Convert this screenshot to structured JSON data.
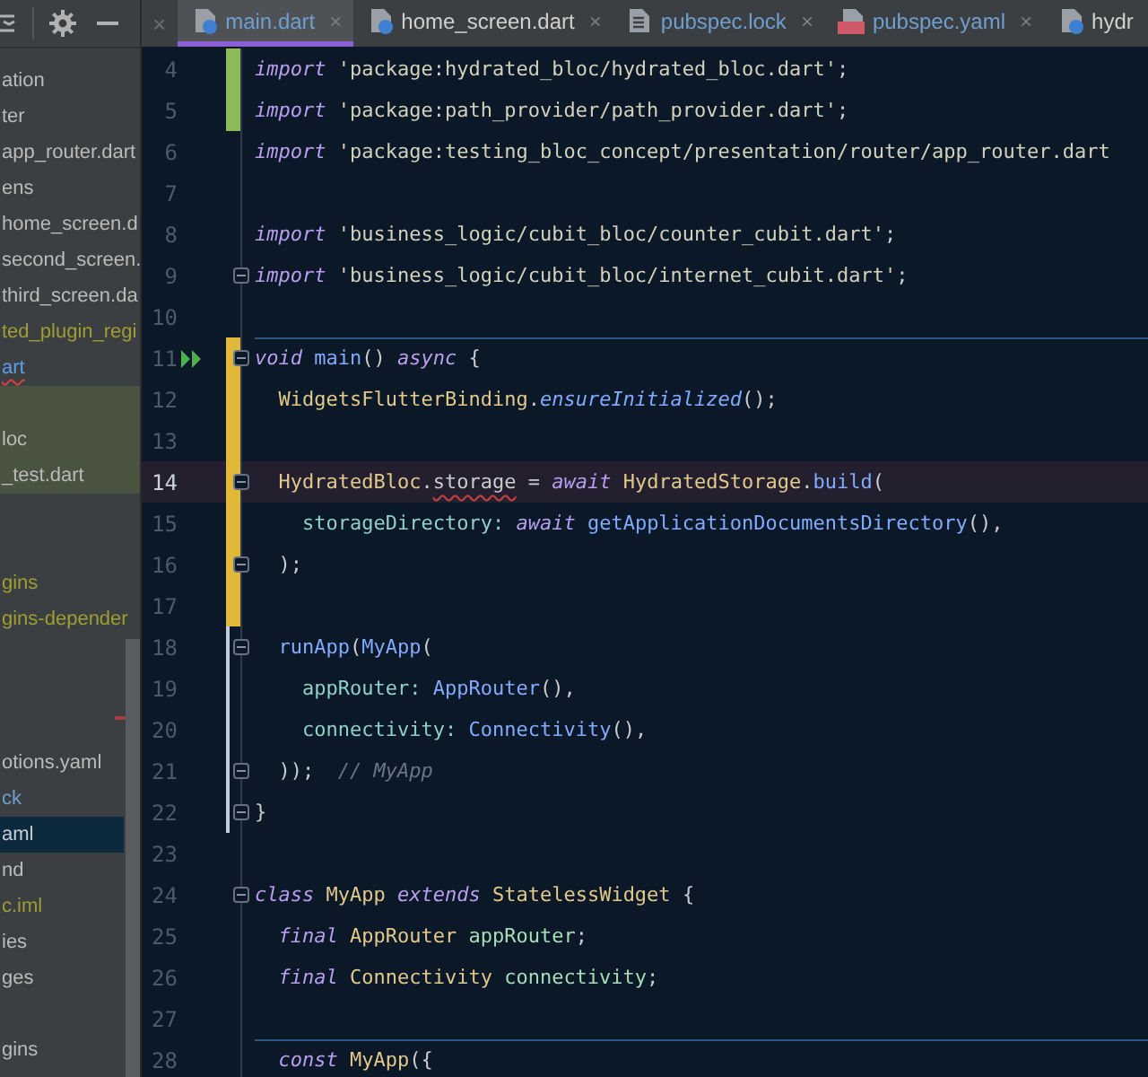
{
  "project_panel": {
    "items": [
      {
        "kind": "item",
        "text": "ation",
        "color": "#bbbbbb",
        "selected": false,
        "highlighted": false
      },
      {
        "kind": "item",
        "text": "ter",
        "color": "#bbbbbb",
        "selected": false,
        "highlighted": false
      },
      {
        "kind": "item",
        "text": "app_router.dart",
        "color": "#bbbbbb",
        "selected": false,
        "highlighted": false
      },
      {
        "kind": "item",
        "text": "ens",
        "color": "#bbbbbb",
        "selected": false,
        "highlighted": false
      },
      {
        "kind": "item",
        "text": "home_screen.d",
        "color": "#bbbbbb",
        "selected": false,
        "highlighted": false
      },
      {
        "kind": "item",
        "text": "second_screen.",
        "color": "#bbbbbb",
        "selected": false,
        "highlighted": false
      },
      {
        "kind": "item",
        "text": "third_screen.da",
        "color": "#bbbbbb",
        "selected": false,
        "highlighted": false
      },
      {
        "kind": "item",
        "text": "ted_plugin_regi",
        "color": "#9e9e32",
        "selected": false,
        "highlighted": false
      },
      {
        "kind": "item",
        "text": "art",
        "color": "#5c9ee8",
        "selected": false,
        "highlighted": false,
        "error": true
      },
      {
        "kind": "blank",
        "highlighted": true
      },
      {
        "kind": "item",
        "text": "loc",
        "color": "#bbbbbb",
        "selected": false,
        "highlighted": true
      },
      {
        "kind": "item",
        "text": "_test.dart",
        "color": "#bbbbbb",
        "selected": false,
        "highlighted": true
      },
      {
        "kind": "blank"
      },
      {
        "kind": "blank"
      },
      {
        "kind": "item",
        "text": "gins",
        "color": "#9e9e32",
        "selected": false,
        "highlighted": false
      },
      {
        "kind": "item",
        "text": "gins-depender",
        "color": "#9e9e32",
        "selected": false,
        "highlighted": false
      },
      {
        "kind": "blank"
      },
      {
        "kind": "blank"
      },
      {
        "kind": "blank"
      },
      {
        "kind": "item",
        "text": "otions.yaml",
        "color": "#bbbbbb",
        "selected": false,
        "highlighted": false
      },
      {
        "kind": "item",
        "text": "ck",
        "color": "#6e9fcf",
        "selected": false,
        "highlighted": false
      },
      {
        "kind": "item",
        "text": "aml",
        "selected": true,
        "highlighted": false
      },
      {
        "kind": "item",
        "text": "nd",
        "color": "#bbbbbb",
        "selected": false,
        "highlighted": false
      },
      {
        "kind": "item",
        "text": "c.iml",
        "color": "#9e9e32",
        "selected": false,
        "highlighted": false
      },
      {
        "kind": "item",
        "text": "ies",
        "color": "#bbbbbb",
        "selected": false,
        "highlighted": false
      },
      {
        "kind": "item",
        "text": "ges",
        "color": "#bbbbbb",
        "selected": false,
        "highlighted": false
      },
      {
        "kind": "blank"
      },
      {
        "kind": "item",
        "text": "gins",
        "color": "#bbbbbb",
        "selected": false,
        "highlighted": false
      }
    ]
  },
  "tab_bar": {
    "overflow_close": "×",
    "tabs": [
      {
        "label": "main.dart",
        "kind": "dart",
        "close": "×",
        "color": "#6e9fcf",
        "selected": true
      },
      {
        "label": "home_screen.dart",
        "kind": "dart",
        "close": "×",
        "color": "#d0d0d0",
        "selected": false
      },
      {
        "label": "pubspec.lock",
        "kind": "file",
        "close": "×",
        "color": "#6e9fcf",
        "selected": false
      },
      {
        "label": "pubspec.yaml",
        "kind": "yaml",
        "close": "×",
        "color": "#6e9fcf",
        "selected": false
      },
      {
        "label": "hydr",
        "kind": "dart",
        "color": "#d0d0d0",
        "selected": false
      }
    ]
  },
  "editor": {
    "lines": [
      {
        "number": "4",
        "kind": "added",
        "current": false,
        "fold": false,
        "run": false,
        "separator": false,
        "tokens": [
          {
            "kind": "kw",
            "text": "import"
          },
          {
            "kind": "str",
            "text": " 'package:hydrated_bloc/hydrated_bloc.dart'"
          },
          {
            "kind": "plain",
            "text": ";"
          }
        ]
      },
      {
        "number": "5",
        "kind": "added",
        "current": false,
        "fold": false,
        "run": false,
        "separator": false,
        "tokens": [
          {
            "kind": "kw",
            "text": "import"
          },
          {
            "kind": "str",
            "text": " 'package:path_provider/path_provider.dart'"
          },
          {
            "kind": "plain",
            "text": ";"
          }
        ]
      },
      {
        "number": "6",
        "kind": "unchanged",
        "current": false,
        "fold": false,
        "run": false,
        "separator": false,
        "tokens": [
          {
            "kind": "kw",
            "text": "import"
          },
          {
            "kind": "str",
            "text": " 'package:testing_bloc_concept/presentation/router/app_router.dart"
          }
        ]
      },
      {
        "number": "7",
        "kind": "unchanged",
        "current": false,
        "fold": false,
        "run": false,
        "separator": false
      },
      {
        "number": "8",
        "kind": "unchanged",
        "current": false,
        "fold": false,
        "run": false,
        "separator": false,
        "tokens": [
          {
            "kind": "kw",
            "text": "import"
          },
          {
            "kind": "str",
            "text": " 'business_logic/cubit_bloc/counter_cubit.dart'"
          },
          {
            "kind": "plain",
            "text": ";"
          }
        ]
      },
      {
        "number": "9",
        "kind": "unchanged",
        "current": false,
        "fold": true,
        "run": false,
        "separator": false,
        "tokens": [
          {
            "kind": "kw",
            "text": "import"
          },
          {
            "kind": "str",
            "text": " 'business_logic/cubit_bloc/internet_cubit.dart'"
          },
          {
            "kind": "plain",
            "text": ";"
          }
        ]
      },
      {
        "number": "10",
        "kind": "unchanged",
        "current": false,
        "fold": false,
        "run": false,
        "separator": false
      },
      {
        "number": "11",
        "kind": "modified",
        "current": false,
        "fold": true,
        "run": true,
        "separator": true,
        "tokens": [
          {
            "kind": "kw",
            "text": "void"
          },
          {
            "kind": "fn",
            "text": " main"
          },
          {
            "kind": "plain",
            "text": "() "
          },
          {
            "kind": "kw",
            "text": "async"
          },
          {
            "kind": "plain",
            "text": " {"
          }
        ]
      },
      {
        "number": "12",
        "kind": "modified",
        "current": false,
        "fold": false,
        "run": false,
        "separator": false,
        "tokens": [
          {
            "kind": "cls",
            "text": "  WidgetsFlutterBinding"
          },
          {
            "kind": "plain",
            "text": "."
          },
          {
            "kind": "fnit",
            "text": "ensureInitialized"
          },
          {
            "kind": "plain",
            "text": "();"
          }
        ]
      },
      {
        "number": "13",
        "kind": "modified",
        "current": false,
        "fold": false,
        "run": false,
        "separator": false
      },
      {
        "number": "14",
        "kind": "modified",
        "current": true,
        "fold": true,
        "run": false,
        "separator": false,
        "tokens": [
          {
            "kind": "cls",
            "text": "  HydratedBloc"
          },
          {
            "kind": "plain",
            "text": "."
          },
          {
            "kind": "warn",
            "text": "storage"
          },
          {
            "kind": "plain",
            "text": " = "
          },
          {
            "kind": "kw",
            "text": "await"
          },
          {
            "kind": "cls",
            "text": " HydratedStorage"
          },
          {
            "kind": "plain",
            "text": "."
          },
          {
            "kind": "fn",
            "text": "build"
          },
          {
            "kind": "plain",
            "text": "("
          }
        ]
      },
      {
        "number": "15",
        "kind": "modified",
        "current": false,
        "fold": false,
        "run": false,
        "separator": false,
        "tokens": [
          {
            "kind": "param",
            "text": "    storageDirectory: "
          },
          {
            "kind": "kw",
            "text": "await"
          },
          {
            "kind": "fn",
            "text": " getApplicationDocumentsDirectory"
          },
          {
            "kind": "plain",
            "text": "(),"
          }
        ]
      },
      {
        "number": "16",
        "kind": "modified",
        "current": false,
        "fold": true,
        "run": false,
        "separator": false,
        "tokens": [
          {
            "kind": "plain",
            "text": "  );"
          }
        ]
      },
      {
        "number": "17",
        "kind": "modified",
        "current": false,
        "fold": false,
        "run": false,
        "separator": false
      },
      {
        "number": "18",
        "kind": "moved",
        "current": false,
        "fold": true,
        "run": false,
        "separator": false,
        "tokens": [
          {
            "kind": "fn",
            "text": "  runApp"
          },
          {
            "kind": "plain",
            "text": "("
          },
          {
            "kind": "fn",
            "text": "MyApp"
          },
          {
            "kind": "plain",
            "text": "("
          }
        ]
      },
      {
        "number": "19",
        "kind": "moved",
        "current": false,
        "fold": false,
        "run": false,
        "separator": false,
        "tokens": [
          {
            "kind": "param",
            "text": "    appRouter: "
          },
          {
            "kind": "fn",
            "text": "AppRouter"
          },
          {
            "kind": "plain",
            "text": "(),"
          }
        ]
      },
      {
        "number": "20",
        "kind": "moved",
        "current": false,
        "fold": false,
        "run": false,
        "separator": false,
        "tokens": [
          {
            "kind": "param",
            "text": "    connectivity: "
          },
          {
            "kind": "fn",
            "text": "Connectivity"
          },
          {
            "kind": "plain",
            "text": "(),"
          }
        ]
      },
      {
        "number": "21",
        "kind": "moved",
        "current": false,
        "fold": true,
        "run": false,
        "separator": false,
        "tokens": [
          {
            "kind": "plain",
            "text": "  ));  "
          },
          {
            "kind": "comment",
            "text": "// MyApp"
          }
        ]
      },
      {
        "number": "22",
        "kind": "moved",
        "current": false,
        "fold": true,
        "run": false,
        "separator": false,
        "tokens": [
          {
            "kind": "plain",
            "text": "}"
          }
        ]
      },
      {
        "number": "23",
        "kind": "unchanged",
        "current": false,
        "fold": false,
        "run": false,
        "separator": false
      },
      {
        "number": "24",
        "kind": "unchanged",
        "current": false,
        "fold": true,
        "run": false,
        "separator": false,
        "tokens": [
          {
            "kind": "kw",
            "text": "class"
          },
          {
            "kind": "cls",
            "text": " MyApp "
          },
          {
            "kind": "kw",
            "text": "extends"
          },
          {
            "kind": "cls",
            "text": " StatelessWidget "
          },
          {
            "kind": "plain",
            "text": "{"
          }
        ]
      },
      {
        "number": "25",
        "kind": "unchanged",
        "current": false,
        "fold": false,
        "run": false,
        "separator": false,
        "tokens": [
          {
            "kind": "kw",
            "text": "  final"
          },
          {
            "kind": "cls",
            "text": " AppRouter"
          },
          {
            "kind": "field",
            "text": " appRouter"
          },
          {
            "kind": "plain",
            "text": ";"
          }
        ]
      },
      {
        "number": "26",
        "kind": "unchanged",
        "current": false,
        "fold": false,
        "run": false,
        "separator": false,
        "tokens": [
          {
            "kind": "kw",
            "text": "  final"
          },
          {
            "kind": "cls",
            "text": " Connectivity"
          },
          {
            "kind": "field",
            "text": " connectivity"
          },
          {
            "kind": "plain",
            "text": ";"
          }
        ]
      },
      {
        "number": "27",
        "kind": "unchanged",
        "current": false,
        "fold": false,
        "run": false,
        "separator": false
      },
      {
        "number": "28",
        "kind": "unchanged",
        "current": false,
        "fold": false,
        "run": false,
        "separator": true,
        "tokens": [
          {
            "kind": "kw",
            "text": "  const"
          },
          {
            "kind": "cls",
            "text": " MyApp"
          },
          {
            "kind": "plain",
            "text": "({"
          }
        ]
      }
    ]
  }
}
